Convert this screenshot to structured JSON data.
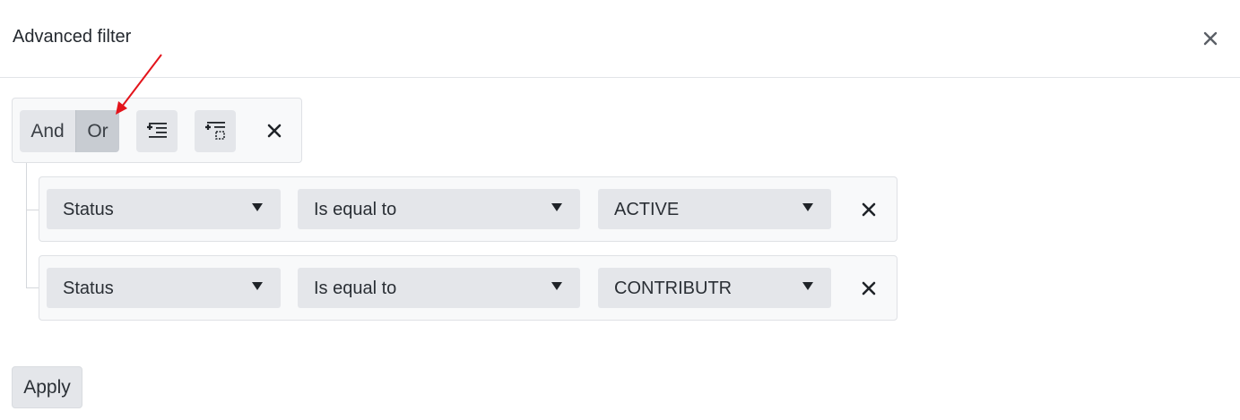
{
  "dialog": {
    "title": "Advanced filter",
    "close_icon": "close-icon"
  },
  "group": {
    "logic_options": [
      "And",
      "Or"
    ],
    "selected_logic": "Or",
    "add_expression_icon": "add-expression-icon",
    "add_group_icon": "add-group-icon",
    "remove_icon": "close-icon"
  },
  "conditions": [
    {
      "field": "Status",
      "operator": "Is equal to",
      "value": "ACTIVE"
    },
    {
      "field": "Status",
      "operator": "Is equal to",
      "value": "CONTRIBUTR"
    }
  ],
  "footer": {
    "apply_label": "Apply"
  },
  "annotation": {
    "arrow_color": "#e3141b",
    "arrow_points_to": "Or"
  },
  "colors": {
    "button_bg": "#e4e6ea",
    "selected_bg": "#c8ccd2",
    "panel_bg": "#f8f9fa",
    "border": "#dfe1e5"
  }
}
